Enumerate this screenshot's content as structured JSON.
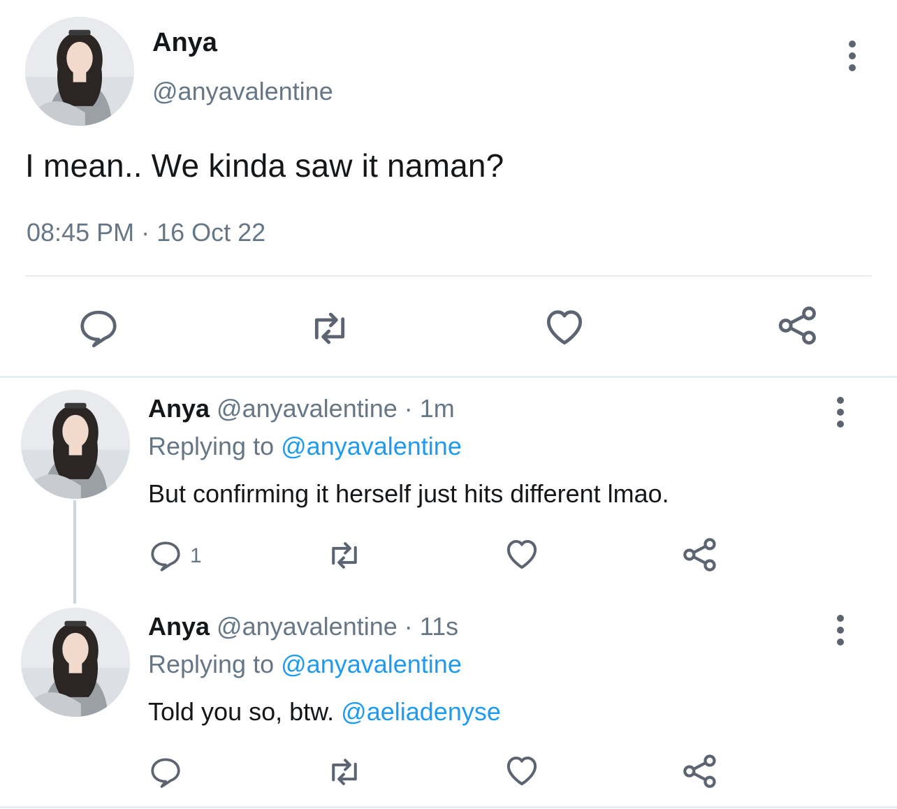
{
  "main_tweet": {
    "name": "Anya",
    "handle": "@anyavalentine",
    "text": "I mean.. We kinda saw it naman?",
    "timestamp": "08:45 PM · 16 Oct 22"
  },
  "replies": [
    {
      "name": "Anya",
      "handle": "@anyavalentine",
      "time": "· 1m",
      "replying_label": "Replying to",
      "replying_to": "@anyavalentine",
      "text": "But confirming it herself just hits different lmao.",
      "reply_count": "1"
    },
    {
      "name": "Anya",
      "handle": "@anyavalentine",
      "time": "· 11s",
      "replying_label": "Replying to",
      "replying_to": "@anyavalentine",
      "text": "Told you so, btw.",
      "mention": "@aeliadenyse",
      "reply_count": ""
    }
  ],
  "icons": {
    "reply": "reply-icon",
    "retweet": "retweet-icon",
    "like": "heart-icon",
    "share": "share-icon",
    "more": "more-options-icon"
  },
  "colors": {
    "link": "#1d9bf0",
    "secondary_text": "#657786",
    "icon": "#5b6470",
    "divider": "#e6ecf0"
  }
}
